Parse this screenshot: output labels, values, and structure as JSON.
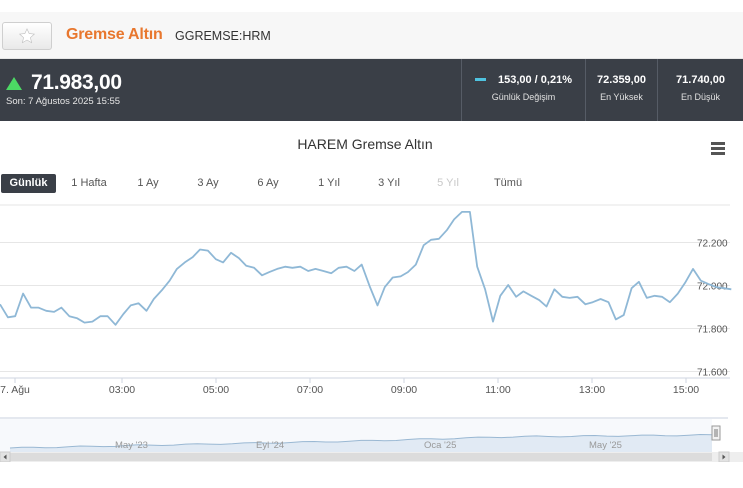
{
  "header": {
    "title": "Gremse Altın",
    "symbol": "GGREMSE:HRM",
    "favorite_icon": "star-icon"
  },
  "quote": {
    "price": "71.983,00",
    "direction": "up",
    "last_update": "Son: 7 Ağustos 2025 15:55",
    "daily_change_value": "153,00 / 0,21%",
    "daily_change_label": "Günlük Değişim",
    "high_value": "72.359,00",
    "high_label": "En Yüksek",
    "low_value": "71.740,00",
    "low_label": "En Düşük"
  },
  "ranges": [
    {
      "label": "Günlük",
      "active": true,
      "disabled": false
    },
    {
      "label": "1 Hafta",
      "active": false,
      "disabled": false
    },
    {
      "label": "1 Ay",
      "active": false,
      "disabled": false
    },
    {
      "label": "3 Ay",
      "active": false,
      "disabled": false
    },
    {
      "label": "6 Ay",
      "active": false,
      "disabled": false
    },
    {
      "label": "1 Yıl",
      "active": false,
      "disabled": false
    },
    {
      "label": "3 Yıl",
      "active": false,
      "disabled": false
    },
    {
      "label": "5 Yıl",
      "active": false,
      "disabled": true
    },
    {
      "label": "Tümü",
      "active": false,
      "disabled": false
    }
  ],
  "chart_data": {
    "type": "line",
    "title": "HAREM Gremse Altın",
    "line_color": "#8fb8d6",
    "x_ticks": [
      "7. Ağu",
      "03:00",
      "05:00",
      "07:00",
      "09:00",
      "11:00",
      "13:00",
      "15:00"
    ],
    "y_ticks": [
      "72.200",
      "72.000",
      "71.800",
      "71.600"
    ],
    "y_tick_values": [
      72200,
      72000,
      71800,
      71600
    ],
    "ylim": [
      71600,
      72200
    ],
    "grid": true,
    "x_hours": [
      0,
      0.17,
      0.33,
      0.5,
      0.67,
      0.83,
      1.0,
      1.17,
      1.33,
      1.5,
      1.67,
      1.83,
      2.0,
      2.17,
      2.33,
      2.5,
      2.67,
      2.83,
      3.0,
      3.17,
      3.33,
      3.5,
      3.67,
      3.83,
      4.0,
      4.17,
      4.33,
      4.5,
      4.67,
      4.83,
      5.0,
      5.17,
      5.33,
      5.5,
      5.67,
      5.83,
      6.0,
      6.17,
      6.33,
      6.5,
      6.67,
      6.83,
      7.0,
      7.17,
      7.33,
      7.5,
      7.67,
      7.83,
      8.0,
      8.17,
      8.33,
      8.5,
      8.67,
      8.83,
      9.0,
      9.17,
      9.33,
      9.5,
      9.67,
      9.83,
      10.0,
      10.17,
      10.33,
      10.5,
      10.67,
      10.83,
      11.0,
      11.17,
      11.33,
      11.5,
      11.67,
      11.83,
      12.0,
      12.17,
      12.33,
      12.5,
      12.67,
      12.83,
      13.0,
      13.17,
      13.33,
      13.5,
      13.67,
      13.83,
      14.0,
      14.17,
      14.33,
      14.5,
      14.67,
      14.83,
      15.0,
      15.17,
      15.33,
      15.5,
      15.67,
      15.83
    ],
    "values": [
      71910,
      71850,
      71855,
      71960,
      71895,
      71895,
      71880,
      71875,
      71895,
      71855,
      71845,
      71825,
      71830,
      71855,
      71855,
      71815,
      71865,
      71905,
      71915,
      71880,
      71935,
      71975,
      72020,
      72075,
      72105,
      72130,
      72165,
      72160,
      72120,
      72105,
      72150,
      72125,
      72090,
      72080,
      72045,
      72060,
      72075,
      72085,
      72080,
      72085,
      72065,
      72075,
      72065,
      72055,
      72080,
      72085,
      72065,
      72095,
      71995,
      71905,
      71990,
      72035,
      72040,
      72060,
      72095,
      72185,
      72210,
      72215,
      72255,
      72305,
      72340,
      72340,
      72085,
      71980,
      71830,
      71950,
      72000,
      71945,
      71970,
      71950,
      71930,
      71900,
      71980,
      71945,
      71940,
      71945,
      71910,
      71920,
      71935,
      71920,
      71840,
      71860,
      71985,
      72015,
      71940,
      71950,
      71945,
      71920,
      71960,
      72010,
      72075,
      72020,
      72005,
      71990,
      71985,
      71980
    ]
  },
  "navigator": {
    "labels": [
      "May '23",
      "Eyl '24",
      "Oca '25",
      "May '25"
    ]
  }
}
